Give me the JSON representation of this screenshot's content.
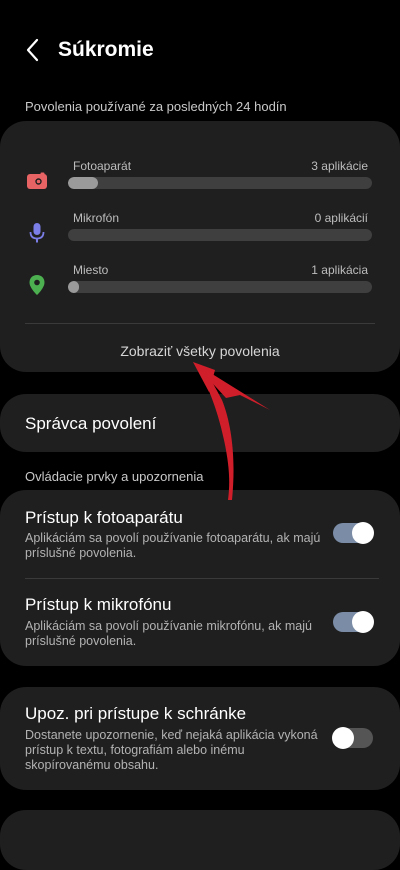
{
  "header": {
    "title": "Súkromie",
    "back_icon": "chevron-left-icon"
  },
  "permissions_section": {
    "label": "Povolenia používané za posledných 24 hodín",
    "items": [
      {
        "name": "Fotoaparát",
        "count": "3 aplikácie",
        "icon": "camera-icon",
        "color": "#e86464",
        "usage": 0.1
      },
      {
        "name": "Mikrofón",
        "count": "0 aplikácií",
        "icon": "microphone-icon",
        "color": "#7c7ee8",
        "usage": 0.0
      },
      {
        "name": "Miesto",
        "count": "1 aplikácia",
        "icon": "location-pin-icon",
        "color": "#4caf50",
        "usage": 0.03
      }
    ],
    "show_all": "Zobraziť všetky povolenia"
  },
  "permission_manager": {
    "label": "Správca povolení"
  },
  "controls_section": {
    "label": "Ovládacie prvky a upozornenia",
    "camera_access": {
      "title": "Prístup k fotoaparátu",
      "desc": "Aplikáciám sa povolí používanie fotoaparátu, ak majú príslušné povolenia.",
      "enabled": true
    },
    "mic_access": {
      "title": "Prístup k mikrofónu",
      "desc": "Aplikáciám sa povolí používanie mikrofónu, ak majú príslušné povolenia.",
      "enabled": true
    }
  },
  "clipboard": {
    "title": "Upoz. pri prístupe k schránke",
    "desc": "Dostanete upozornenie, keď nejaká aplikácia vykoná prístup k textu, fotografiám alebo inému skopírovanému obsahu.",
    "enabled": false
  },
  "accent_colors": {
    "toggle_on": "#7b8da6",
    "annotation_arrow": "#d01f2a"
  }
}
